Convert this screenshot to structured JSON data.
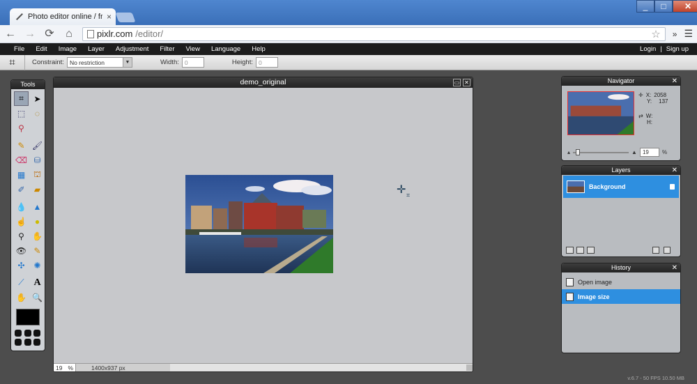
{
  "browser": {
    "tab_title": "Photo editor online / free",
    "tab_close": "×",
    "url_host": "pixlr.com",
    "url_path": "/editor/",
    "ext_label": "»",
    "window_min": "_",
    "window_max": "□",
    "window_close": "✕"
  },
  "menu": {
    "items": [
      "File",
      "Edit",
      "Image",
      "Layer",
      "Adjustment",
      "Filter",
      "View",
      "Language",
      "Help"
    ],
    "login": "Login",
    "separator": "|",
    "signup": "Sign up"
  },
  "options": {
    "constraint_label": "Constraint:",
    "constraint_value": "No restriction",
    "width_label": "Width:",
    "width_value": "0",
    "height_label": "Height:",
    "height_value": "0"
  },
  "tools": {
    "title": "Tools"
  },
  "document": {
    "title": "demo_original",
    "zoom": "19",
    "zoom_unit": "%",
    "size": "1400x937 px"
  },
  "navigator": {
    "title": "Navigator",
    "x_label": "X:",
    "x_value": "2058",
    "y_label": "Y:",
    "y_value": "137",
    "w_label": "W:",
    "h_label": "H:",
    "zoom": "19",
    "zoom_unit": "%"
  },
  "layers": {
    "title": "Layers",
    "items": [
      {
        "name": "Background"
      }
    ]
  },
  "history": {
    "title": "History",
    "items": [
      {
        "label": "Open image"
      },
      {
        "label": "Image size"
      }
    ]
  },
  "footer": {
    "fps": "v.6.7 - 50 FPS 10.50 MB"
  },
  "colors": {
    "selection": "#2e8fe0",
    "panel_header": "#232323",
    "workspace": "#4d4d4d"
  }
}
